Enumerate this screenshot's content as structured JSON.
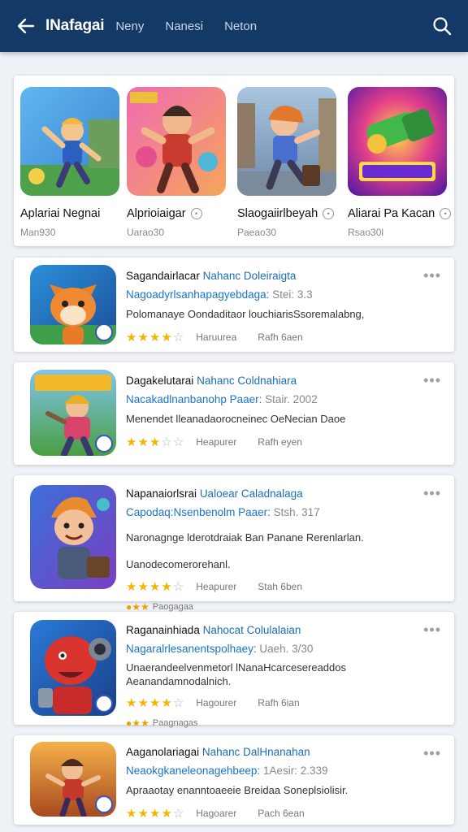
{
  "header": {
    "title": "INafagai",
    "tabs": [
      "Neny",
      "Nanesi",
      "Neton"
    ],
    "bg_color": "#133a66"
  },
  "featured": [
    {
      "name": "Aplariai Negnai",
      "sub": "Man930",
      "icon": "hero-flying-icon",
      "has_badge": false
    },
    {
      "name": "Alprioiaigar",
      "sub": "Uarao30",
      "icon": "action-hero-icon",
      "has_badge": true
    },
    {
      "name": "Slaogaiirlbeyah",
      "sub": "Paeao30",
      "icon": "runner-boy-icon",
      "has_badge": true
    },
    {
      "name": "Aliarai Pa Kacan",
      "sub": "Rsao30l",
      "icon": "blaster-game-icon",
      "has_badge": true
    }
  ],
  "apps": [
    {
      "title": "Sagandairlacar",
      "title_accent": "Nahanc Doleiraigta",
      "sub": "Nagoadyrlsanhapagyebdaga:",
      "sub_meta": "Stei: 3.3",
      "desc": "Polomanaye Oondaditaor louchiarisSsoremalabng,",
      "stars": 4,
      "rating_label": "Haruurea",
      "rating_extra": "Rafh 6aen",
      "tag": "",
      "icon": "fox-character-icon"
    },
    {
      "title": "Dagakelutarai",
      "title_accent": "Nahanc Coldnahiara",
      "sub": "Nacakadlnanbanohp Paaer:",
      "sub_meta": "Stair. 2002",
      "desc": "Menendet lleanadaorocneinec OeNecian Daoe",
      "stars": 3,
      "rating_label": "Heapurer",
      "rating_extra": "Rafh eyen",
      "tag": "",
      "icon": "armor-kid-icon"
    },
    {
      "title": "Napanaiorlsrai",
      "title_accent": "Ualoear Caladnalaga",
      "sub": "Capodaq:Nsenbenolm Paaer:",
      "sub_meta": "Stsh. 317",
      "desc": "Naronagnge lderotdraiak Ban Panane Rerenlarlan. Uanodecomerorehanl.",
      "stars": 4,
      "rating_label": "Heapurer",
      "rating_extra": "Stah 6ben",
      "tag": "Paogagaa",
      "icon": "blond-warrior-icon"
    },
    {
      "title": "Raganainhiada",
      "title_accent": "Nahocat Colulalaian",
      "sub": "Nagaralrlesanentspolhaey:",
      "sub_meta": "Uaeh. 3/30",
      "desc": "Unaerandeelvenmetorl lNanaHcarcesereaddos Aeanandamnodalnich.",
      "stars": 4,
      "rating_label": "Hagourer",
      "rating_extra": "Rafh 6ian",
      "tag": "Paagnagas",
      "icon": "red-robot-icon"
    },
    {
      "title": "Aaganolariagai",
      "title_accent": "Nahanc DalHnanahan",
      "sub": "Neaokgkaneleonagehbeep:",
      "sub_meta": "1Aesir: 2.339",
      "desc": "Apraaotay enanntoaeeie Breidaa Soneplsiolisir.",
      "stars": 4,
      "rating_label": "Hagoarer",
      "rating_extra": "Pach 6ean",
      "tag": "",
      "icon": "adventurer-kid-icon"
    }
  ]
}
